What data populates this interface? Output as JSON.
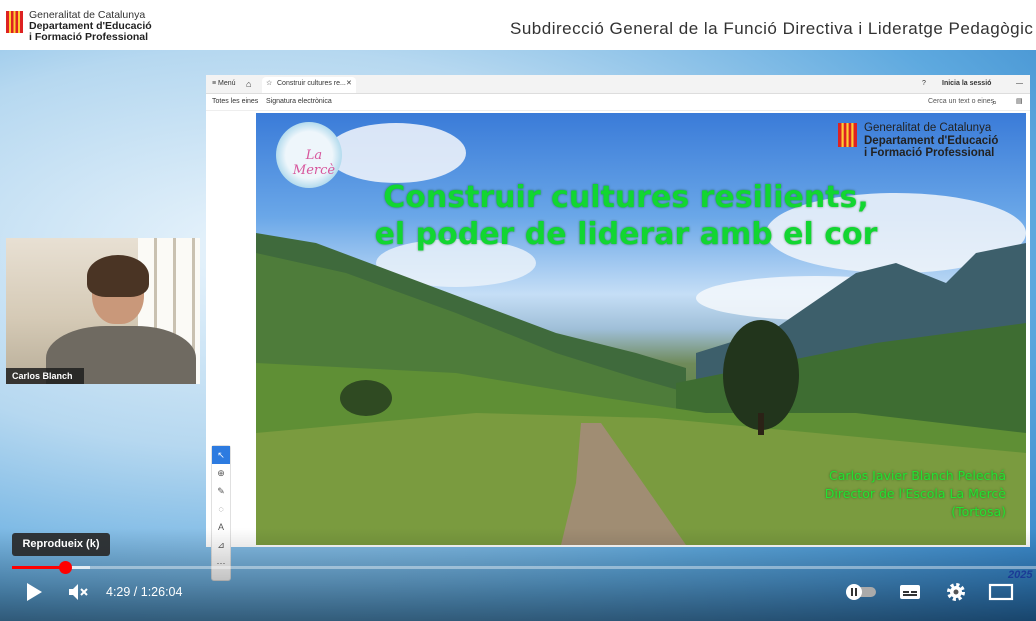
{
  "banner": {
    "org_line1": "Generalitat de Catalunya",
    "org_line2": "Departament d'Educació",
    "org_line3": "i Formació Professional",
    "title": "Subdirecció General de la Funció Directiva i Lideratge Pedagògic"
  },
  "webcam": {
    "name": "Carlos Blanch"
  },
  "screen": {
    "tabbar": {
      "menu": "Menú",
      "tab_title": "Construir cultures re...",
      "signin": "Inicia la sessió"
    },
    "toolbar": {
      "all_tools": "Totes les eines",
      "esign": "Signatura electrònica",
      "search_placeholder": "Cerca un text o eines"
    }
  },
  "slide": {
    "logo_text": "La Mercè",
    "org_line1": "Generalitat de Catalunya",
    "org_line2": "Departament d'Educació",
    "org_line3": "i Formació Professional",
    "title_line1": "Construir cultures resilients,",
    "title_line2": "el poder de liderar amb el cor",
    "author_line1": "Carlos Javier Blanch Pelechá",
    "author_line2": "Director de l'Escola La Mercè",
    "author_line3": "(Tortosa)"
  },
  "player": {
    "tooltip": "Reprodueix (k)",
    "time": "4:29 / 1:26:04",
    "progress": 0.052,
    "year_overlay": "2025",
    "accent": "#ff0000"
  }
}
